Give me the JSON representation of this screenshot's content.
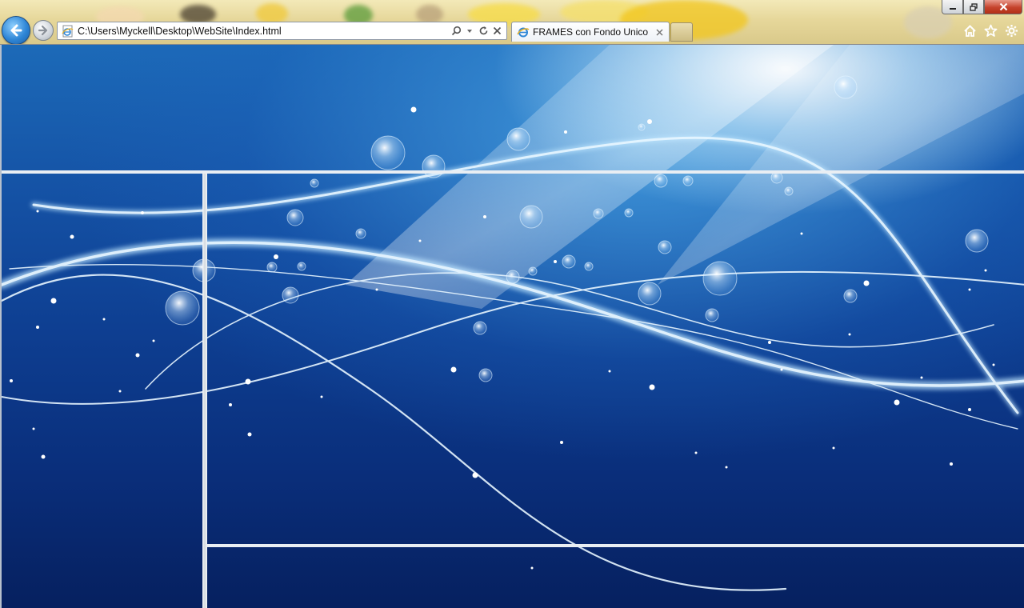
{
  "browser": {
    "address": "C:\\Users\\Myckell\\Desktop\\WebSite\\Index.html",
    "tab_title": "FRAMES con Fondo Unico",
    "icons": {
      "back": "back-arrow-icon",
      "forward": "forward-arrow-icon",
      "page": "ie-page-icon",
      "search": "search-icon",
      "dropdown": "chevron-down-icon",
      "refresh": "refresh-icon",
      "stop": "stop-icon",
      "tab_close": "close-icon",
      "home": "home-icon",
      "favorites": "star-icon",
      "tools": "gear-icon"
    },
    "colors": {
      "chrome": "#e6d79a",
      "close_button": "#c5432c",
      "back_button": "#2f86d6"
    }
  },
  "page": {
    "background": "blue abstract wallpaper with light waves and bubbles",
    "frames": [
      "header",
      "menu",
      "content",
      "footer"
    ],
    "frame_border_color": "#e9eef3"
  }
}
